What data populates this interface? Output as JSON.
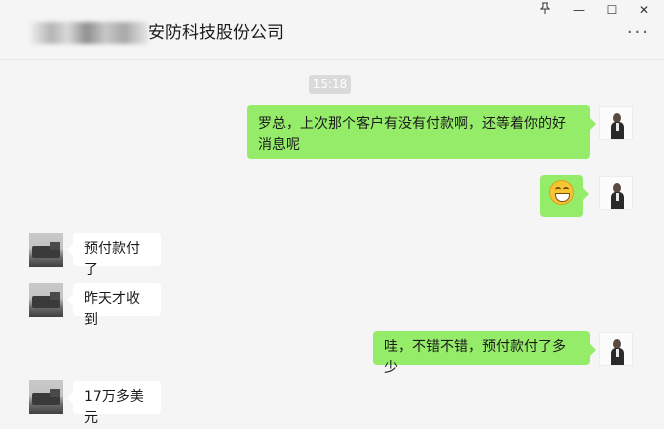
{
  "window": {
    "pin_icon": "pin-icon",
    "minimize_glyph": "—",
    "maximize_glyph": "☐",
    "close_glyph": "✕"
  },
  "header": {
    "title": "安防科技股份公司",
    "more_label": "···"
  },
  "chat": {
    "timestamp": "15:18",
    "messages": [
      {
        "sender": "me",
        "text": "罗总，上次那个客户有没有付款啊，还等着你的好消息呢"
      },
      {
        "sender": "me",
        "emoji": "grinning-face-emoji"
      },
      {
        "sender": "other",
        "text": "预付款付了"
      },
      {
        "sender": "other",
        "text": "昨天才收到"
      },
      {
        "sender": "me",
        "text": "哇，不错不错，预付款付了多少"
      },
      {
        "sender": "other",
        "text": "17万多美元"
      }
    ]
  },
  "colors": {
    "my_bubble": "#95ec69",
    "other_bubble": "#ffffff",
    "background": "#f5f5f5"
  }
}
